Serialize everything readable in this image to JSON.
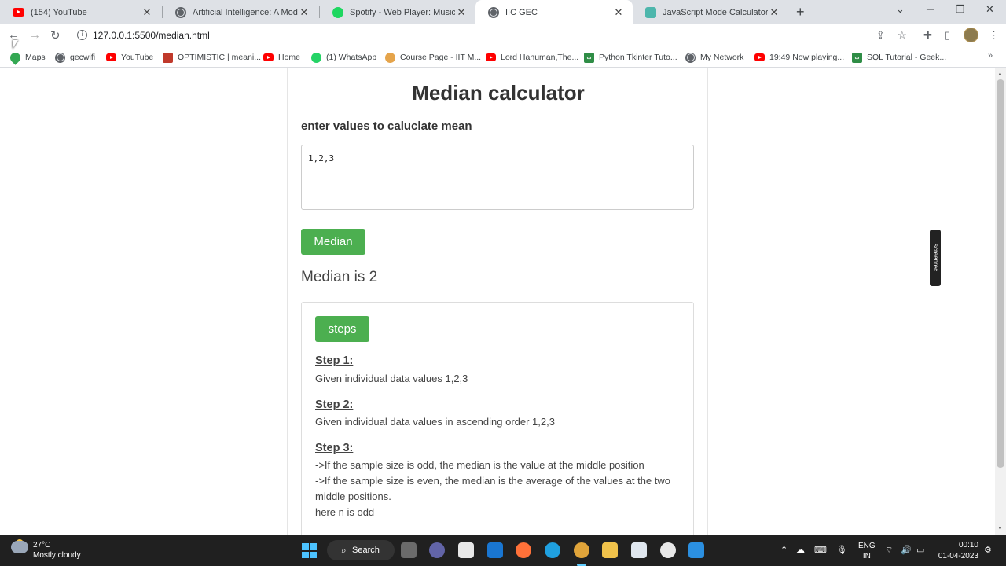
{
  "browser": {
    "tabs": [
      {
        "title": "(154) YouTube",
        "icon": "youtube-icon"
      },
      {
        "title": "Artificial Intelligence: A Modern A",
        "icon": "globe-icon"
      },
      {
        "title": "Spotify - Web Player: Music for e",
        "icon": "spotify-icon"
      },
      {
        "title": "IIC GEC",
        "icon": "globe-icon",
        "active": true
      },
      {
        "title": "JavaScript Mode Calculator",
        "icon": "calculator-icon"
      }
    ],
    "url": "127.0.0.1:5500/median.html",
    "bookmarks": [
      "Maps",
      "gecwifi",
      "YouTube",
      "OPTIMISTIC | meani...",
      "Home",
      "(1) WhatsApp",
      "Course Page - IIT M...",
      "Lord Hanuman,The...",
      "Python Tkinter Tuto...",
      "My Network",
      "19:49 Now playing...",
      "SQL Tutorial - Geek..."
    ]
  },
  "page": {
    "title": "Median calculator",
    "subtitle": "enter values to caluclate mean",
    "input_value": "1,2,3",
    "median_button": "Median",
    "result": "Median is 2",
    "steps_button": "steps",
    "step1_heading": "Step 1:",
    "step1_text": "Given individual data values 1,2,3",
    "step2_heading": "Step 2:",
    "step2_text": "Given individual data values in ascending order 1,2,3",
    "step3_heading": "Step 3:",
    "step3_line1": "->If the sample size is odd, the median is the value at the middle position",
    "step3_line2": "->If the sample size is even, the median is the average of the values at the two middle positions.",
    "step3_line3": "here n is odd",
    "accent_color": "#4caf50"
  },
  "overlay": {
    "screenrec_label": "screenrec"
  },
  "taskbar": {
    "temperature": "27°C",
    "condition": "Mostly cloudy",
    "search": "Search",
    "lang1": "ENG",
    "lang2": "IN",
    "time": "00:10",
    "date": "01-04-2023"
  }
}
